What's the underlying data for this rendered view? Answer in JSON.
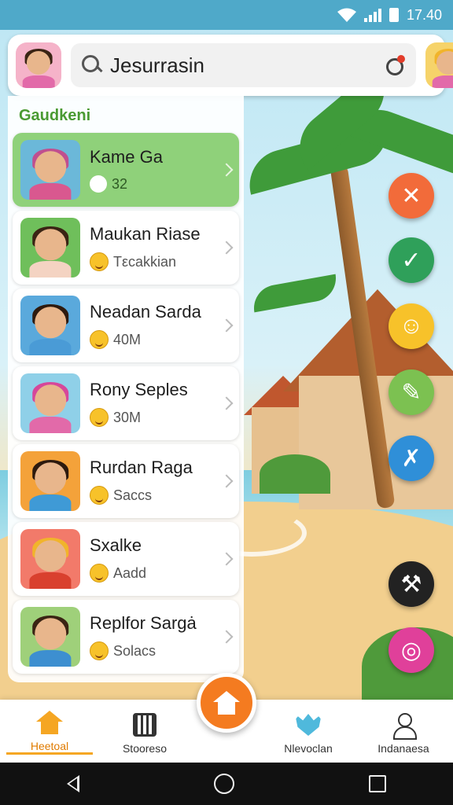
{
  "status_bar": {
    "time": "17.40"
  },
  "header": {
    "search_value": "Jesurrasin"
  },
  "list": {
    "section_title": "Gaudkeni",
    "items": [
      {
        "title": "Kame Ga",
        "subtitle": "32",
        "sub_icon": "gear-icon",
        "active": true,
        "colors": {
          "bg": "#6bb8d9",
          "hair": "#c04f8f",
          "body": "#d9588f"
        }
      },
      {
        "title": "Maukan Riase",
        "subtitle": "Tεcakkian",
        "sub_icon": "smile-emoji-icon",
        "active": false,
        "colors": {
          "bg": "#6fbf5b",
          "hair": "#3a2414",
          "body": "#f4d3c2"
        }
      },
      {
        "title": "Neadan Saɾda",
        "subtitle": "40M",
        "sub_icon": "smile-emoji-icon",
        "active": false,
        "colors": {
          "bg": "#5aa9dc",
          "hair": "#2e1a0e",
          "body": "#4a9bd6"
        }
      },
      {
        "title": "Rony Seples",
        "subtitle": "30M",
        "sub_icon": "smile-emoji-icon",
        "active": false,
        "colors": {
          "bg": "#8fd0e8",
          "hair": "#d6479a",
          "body": "#e26aa9"
        }
      },
      {
        "title": "Rurdan Raga",
        "subtitle": "Saccs",
        "sub_icon": "kiss-emoji-icon",
        "active": false,
        "colors": {
          "bg": "#f4a23a",
          "hair": "#2d1a0e",
          "body": "#3f9ad6"
        }
      },
      {
        "title": "Sxalke",
        "subtitle": "Aadd",
        "sub_icon": "smile-emoji-icon",
        "active": false,
        "colors": {
          "bg": "#f27a6a",
          "hair": "#f1b42b",
          "body": "#d9402e"
        }
      },
      {
        "title": "Replfor Sargȧ",
        "subtitle": "Solacs",
        "sub_icon": "kiss-emoji-icon",
        "active": false,
        "colors": {
          "bg": "#9fd07a",
          "hair": "#3a2414",
          "body": "#3d8fd0"
        }
      }
    ]
  },
  "fabs": [
    {
      "icon": "close-icon",
      "glyph": "✕",
      "color": "#f26b3a"
    },
    {
      "icon": "check-icon",
      "glyph": "✓",
      "color": "#2fa05a"
    },
    {
      "icon": "smile-icon",
      "glyph": "☺",
      "color": "#f7c22a"
    },
    {
      "icon": "pin-icon",
      "glyph": "✎",
      "color": "#7cc151"
    },
    {
      "icon": "tools-icon",
      "glyph": "✗",
      "color": "#2f8fd8"
    },
    {
      "icon": "hammer-icon",
      "glyph": "⚒",
      "color": "#222222"
    },
    {
      "icon": "target-icon",
      "glyph": "◎",
      "color": "#e0409a"
    }
  ],
  "bottom_nav": {
    "items": [
      {
        "label": "Heetoal",
        "icon": "home-icon",
        "active": true
      },
      {
        "label": "Stooreso",
        "icon": "grid-icon",
        "active": false
      },
      {
        "label": "Nlevoclan",
        "icon": "heart-icon",
        "active": false
      },
      {
        "label": "Indanaesa",
        "icon": "user-icon",
        "active": false
      }
    ],
    "center_icon": "home-icon"
  },
  "colors": {
    "accent": "#f47b20",
    "active_card": "#8fd17a",
    "status_bar": "#4fa9c9"
  }
}
